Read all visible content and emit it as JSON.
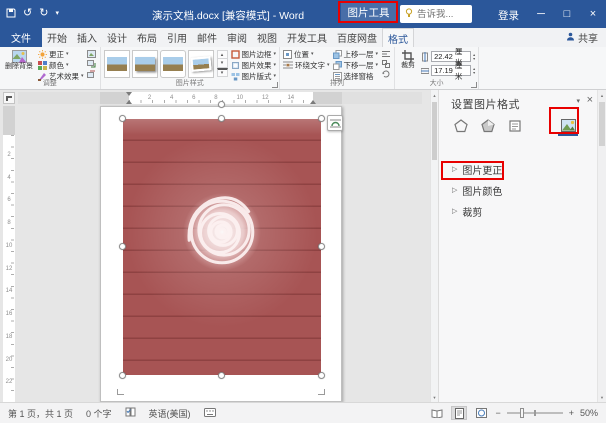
{
  "colors": {
    "titlebar_blue": "#2b579a",
    "accent": "#2b579a",
    "annotation_red": "#e80000",
    "image_red": "#a75454"
  },
  "icons": {
    "undo": "↺",
    "redo": "↻",
    "dropdown": "▾",
    "tri_up": "▴",
    "tri_down": "▾",
    "minimize": "─",
    "maximize": "□",
    "close": "×",
    "scroll_up": "▲",
    "scroll_down": "▼",
    "zoom_out": "−",
    "zoom_in": "+",
    "expander": "▷"
  },
  "titlebar": {
    "title": "演示文档.docx [兼容模式] - Word",
    "contextual_group": "图片工具",
    "tellme_placeholder": "告诉我...",
    "sign_in": "登录"
  },
  "tabs": {
    "file": "文件",
    "items": [
      "开始",
      "插入",
      "设计",
      "布局",
      "引用",
      "邮件",
      "审阅",
      "视图",
      "开发工具",
      "百度网盘",
      "格式"
    ],
    "share": "共享"
  },
  "ribbon": {
    "adjust": {
      "group_label": "调整",
      "remove_background": "删除背景",
      "corrections": "更正",
      "color": "颜色",
      "artistic_effects": "艺术效果"
    },
    "picture_styles": {
      "group_label": "图片样式",
      "picture_border": "图片边框",
      "picture_effects": "图片效果",
      "picture_layout": "图片版式"
    },
    "arrange": {
      "group_label": "排列",
      "position": "位置",
      "wrap_text": "环绕文字",
      "bring_forward": "上移一层",
      "send_backward": "下移一层",
      "selection_pane": "选择窗格"
    },
    "size": {
      "group_label": "大小",
      "crop": "裁剪",
      "height_value": "22.42",
      "width_value": "17.19",
      "unit": "厘米"
    }
  },
  "rulers": {
    "h": [
      "2",
      "4",
      "6",
      "8",
      "10",
      "12",
      "14"
    ],
    "v": [
      "2",
      "4",
      "6",
      "8",
      "10",
      "12",
      "14",
      "16",
      "18",
      "20",
      "22"
    ]
  },
  "task_pane": {
    "title": "设置图片格式",
    "sections": [
      {
        "label": "图片更正"
      },
      {
        "label": "图片颜色"
      },
      {
        "label": "裁剪"
      }
    ]
  },
  "status_bar": {
    "page_info": "第 1 页，共 1 页",
    "word_count": "0 个字",
    "language": "英语(美国)",
    "zoom_level": "50%"
  }
}
